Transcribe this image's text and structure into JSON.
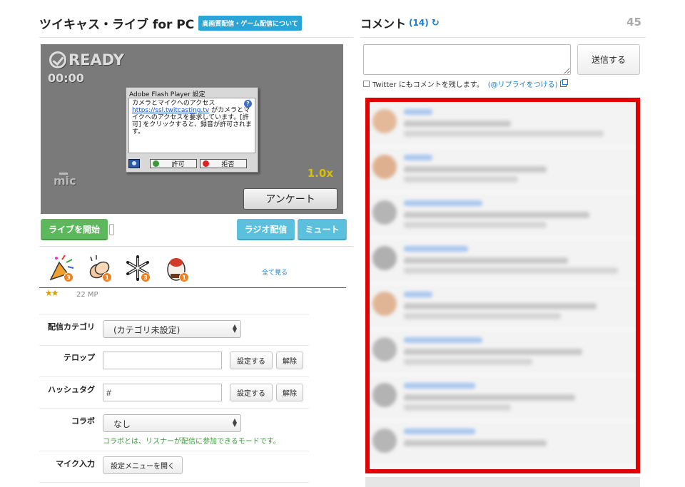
{
  "header": {
    "title": "ツイキャス・ライブ for PC",
    "hq_badge": "高画質配信・ゲーム配信について"
  },
  "player": {
    "status": "READY",
    "timer": "00:00",
    "mic_label": "mic",
    "zoom": "1.0x",
    "survey_button": "アンケート"
  },
  "flash_dialog": {
    "title": "Adobe Flash Player 設定",
    "heading": "カメラとマイクへのアクセス",
    "link": "https://ssl.twitcasting.tv",
    "body_rest": " がカメラとマイクへのアクセスを要求しています。[許可] をクリックすると、録音が許可されます。",
    "help": "?",
    "allow": "許可",
    "deny": "拒否"
  },
  "controls": {
    "start_live": "ライブを開始",
    "radio": "ラジオ配信",
    "mute": "ミュート"
  },
  "gifts": {
    "items": [
      {
        "icon": "cracker-icon",
        "count": "3"
      },
      {
        "icon": "clap-icon",
        "count": "1"
      },
      {
        "icon": "snowflake-icon",
        "count": "3"
      },
      {
        "icon": "cake-icon",
        "count": "1"
      }
    ],
    "see_all": "全て見る"
  },
  "level": {
    "stars": "★★",
    "mp": "22 MP"
  },
  "form": {
    "category": {
      "label": "配信カテゴリ",
      "value": "(カテゴリ未設定)"
    },
    "telop": {
      "label": "テロップ",
      "value": "",
      "set": "設定する",
      "clear": "解除"
    },
    "hashtag": {
      "label": "ハッシュタグ",
      "value": "#",
      "set": "設定する",
      "clear": "解除"
    },
    "collab": {
      "label": "コラボ",
      "value": "なし",
      "note": "コラボとは、リスナーが配信に参加できるモードです。"
    },
    "mic": {
      "label": "マイク入力",
      "button": "設定メニューを開く"
    }
  },
  "comments": {
    "title": "コメント",
    "count": "(14)",
    "viewer_count": "45",
    "send": "送信する",
    "twitter_text": "Twitter にもコメントを残します。",
    "reply_link": "(@リプライをつける)"
  },
  "colors": {
    "highlight_border": "#e00000",
    "accent_blue": "#5bc0de",
    "accent_green": "#5cb85c",
    "link": "#1a7fd0"
  }
}
